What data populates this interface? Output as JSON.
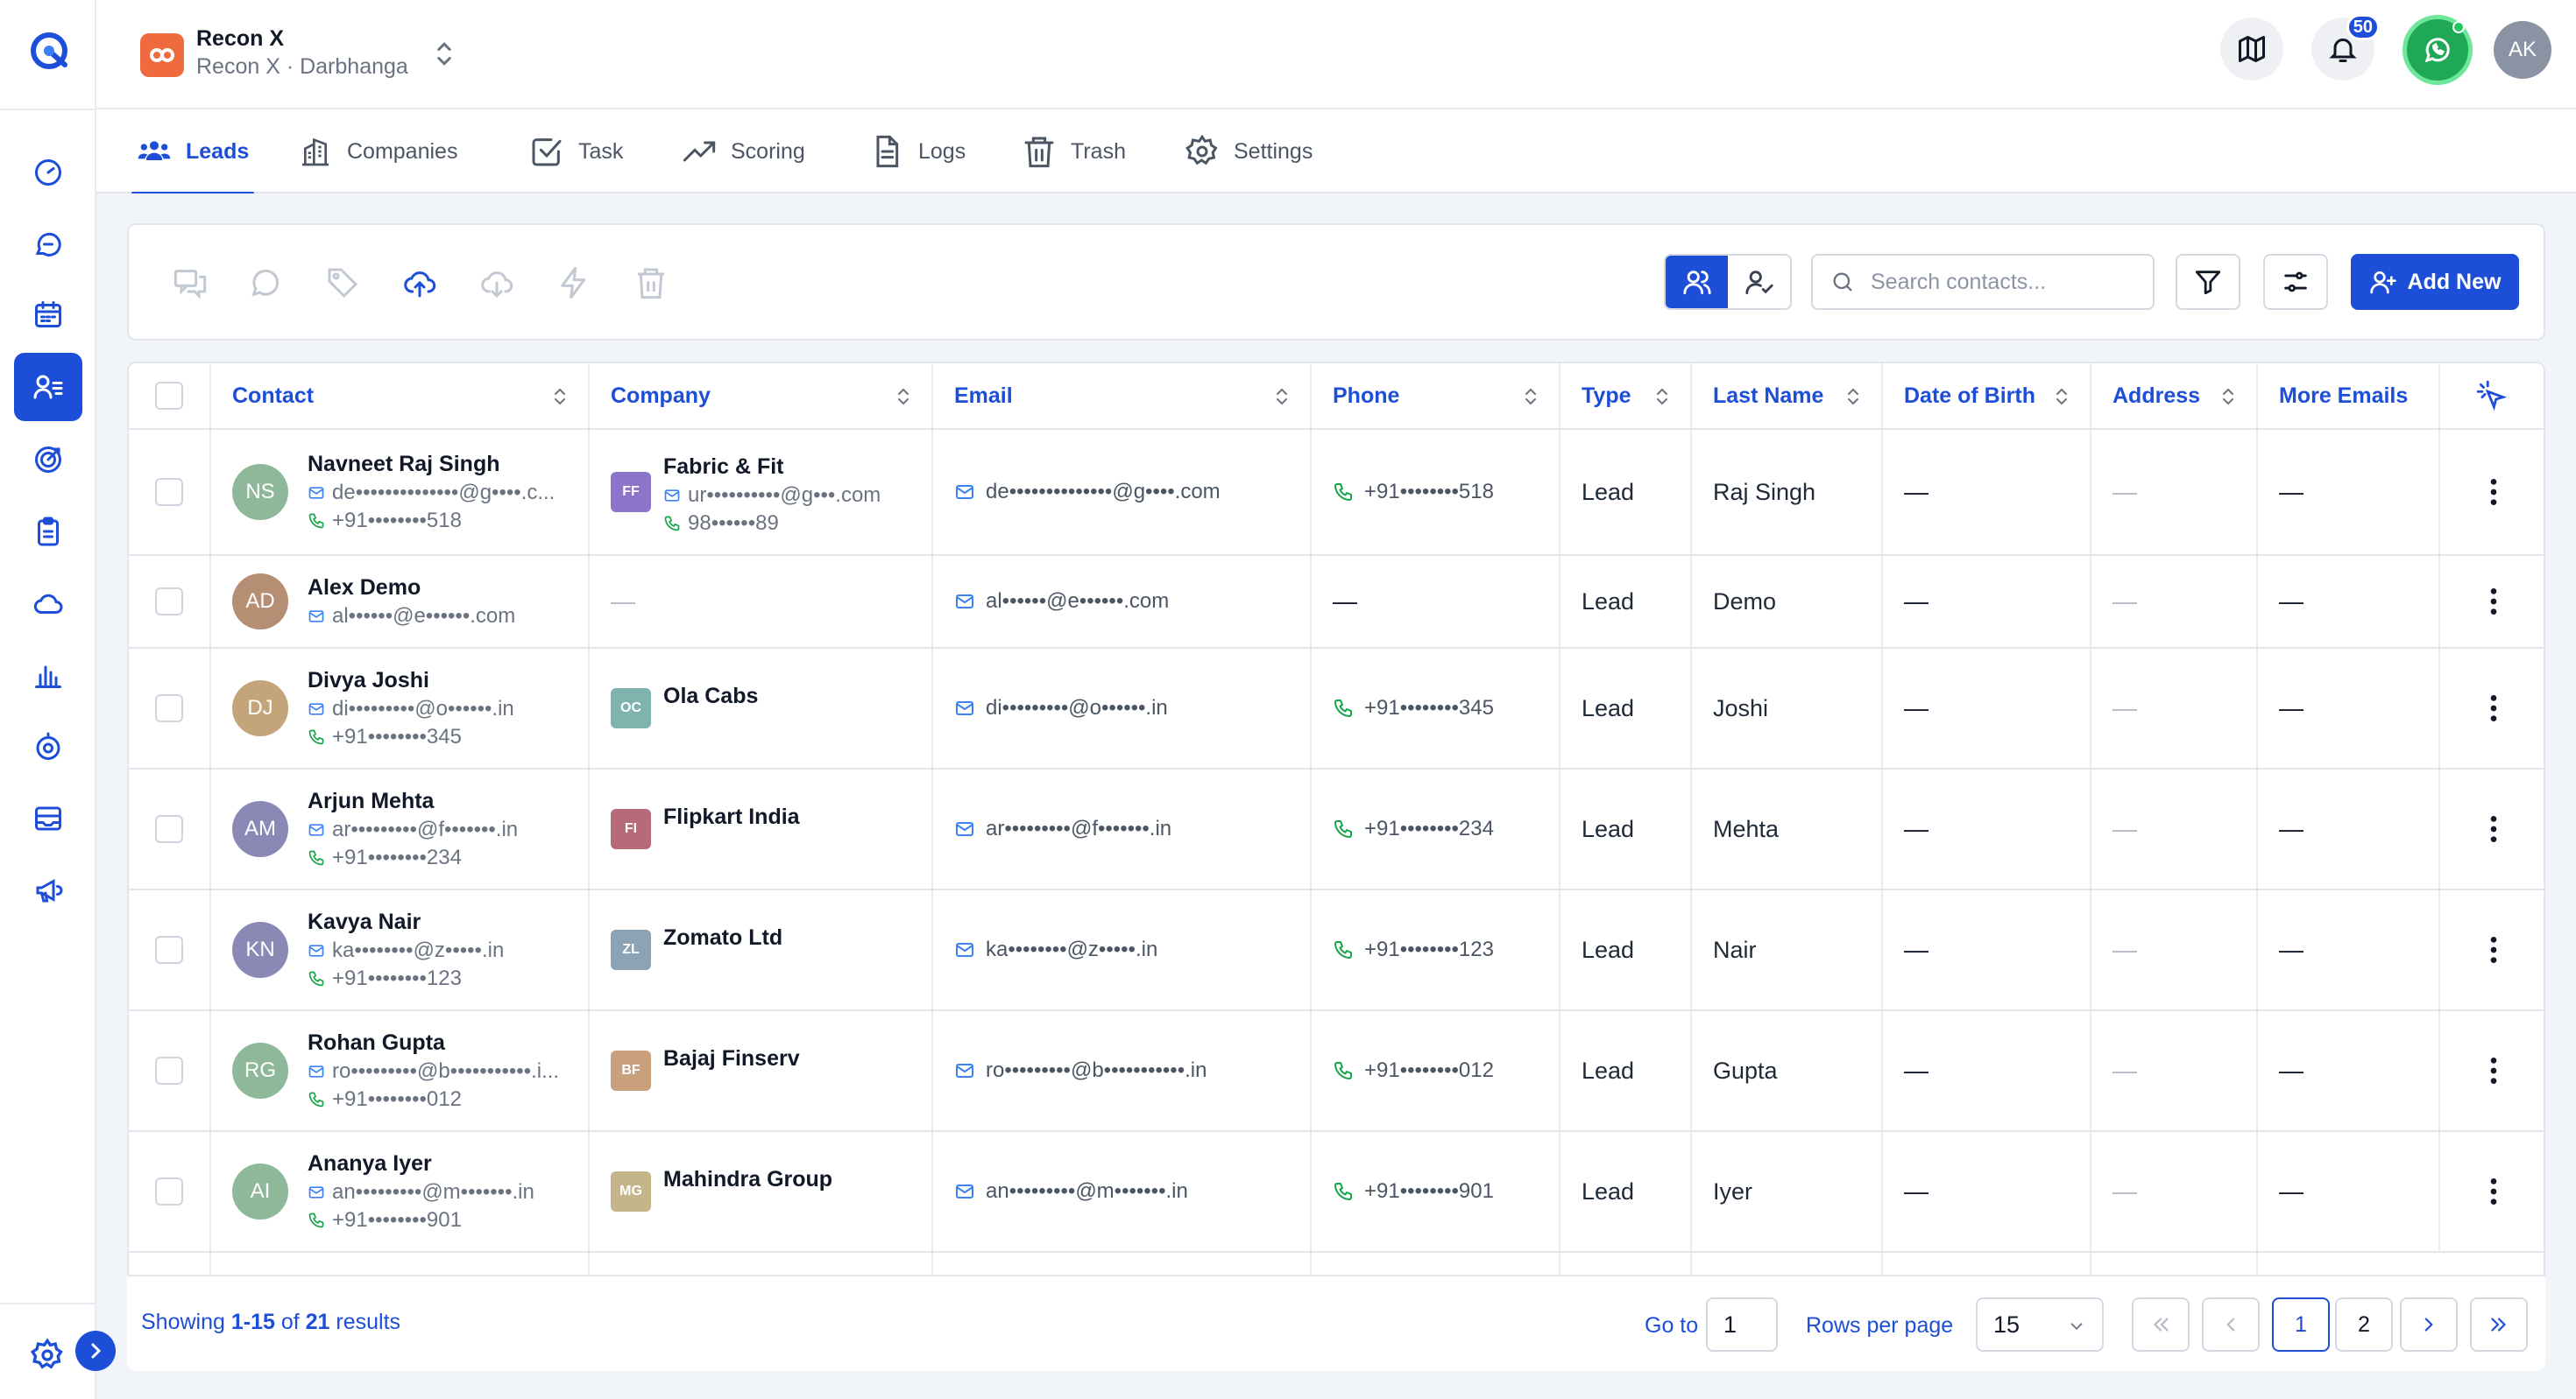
{
  "workspace": {
    "name": "Recon X",
    "subtitle": "Recon X · Darbhanga"
  },
  "header": {
    "notification_count": "50",
    "user_initials": "AK"
  },
  "tabs": [
    {
      "label": "Leads",
      "icon": "users-icon"
    },
    {
      "label": "Companies",
      "icon": "building-icon"
    },
    {
      "label": "Task",
      "icon": "checkbox-icon"
    },
    {
      "label": "Scoring",
      "icon": "trending-up-icon"
    },
    {
      "label": "Logs",
      "icon": "document-icon"
    },
    {
      "label": "Trash",
      "icon": "trash-icon"
    },
    {
      "label": "Settings",
      "icon": "gear-icon"
    }
  ],
  "toolbar": {
    "search_placeholder": "Search contacts...",
    "add_label": "Add New"
  },
  "table": {
    "columns": [
      "Contact",
      "Company",
      "Email",
      "Phone",
      "Type",
      "Last Name",
      "Date of Birth",
      "Address",
      "More Emails"
    ],
    "rows": [
      {
        "initials": "NS",
        "avatar_color": "#8fb89a",
        "name": "Navneet Raj Singh",
        "email_short": "de••••••••••••••@g••••.c...",
        "phone": "+91••••••••518",
        "company": "Fabric & Fit",
        "company_initials": "FF",
        "company_color": "#8b74c9",
        "company_email": "ur••••••••••@g•••.com",
        "company_phone": "98••••••89",
        "email": "de••••••••••••••@g••••.com",
        "phone_col": "+91••••••••518",
        "type": "Lead",
        "last_name": "Raj Singh",
        "dob": "—",
        "address": "—",
        "more_emails": "—"
      },
      {
        "initials": "AD",
        "avatar_color": "#b68e73",
        "name": "Alex Demo",
        "email_short": "al••••••@e••••••.com",
        "phone": "",
        "company": "",
        "company_initials": "",
        "company_color": "",
        "company_email": "",
        "company_phone": "",
        "email": "al••••••@e••••••.com",
        "phone_col": "—",
        "type": "Lead",
        "last_name": "Demo",
        "dob": "—",
        "address": "—",
        "more_emails": "—"
      },
      {
        "initials": "DJ",
        "avatar_color": "#c4a57a",
        "name": "Divya Joshi",
        "email_short": "di•••••••••@o••••••.in",
        "phone": "+91••••••••345",
        "company": "Ola Cabs",
        "company_initials": "OC",
        "company_color": "#7fb3ad",
        "company_email": "",
        "company_phone": "",
        "email": "di•••••••••@o••••••.in",
        "phone_col": "+91••••••••345",
        "type": "Lead",
        "last_name": "Joshi",
        "dob": "—",
        "address": "—",
        "more_emails": "—"
      },
      {
        "initials": "AM",
        "avatar_color": "#8a88b5",
        "name": "Arjun Mehta",
        "email_short": "ar•••••••••@f•••••••.in",
        "phone": "+91••••••••234",
        "company": "Flipkart India",
        "company_initials": "FI",
        "company_color": "#b76b78",
        "company_email": "",
        "company_phone": "",
        "email": "ar•••••••••@f•••••••.in",
        "phone_col": "+91••••••••234",
        "type": "Lead",
        "last_name": "Mehta",
        "dob": "—",
        "address": "—",
        "more_emails": "—"
      },
      {
        "initials": "KN",
        "avatar_color": "#8a88b5",
        "name": "Kavya Nair",
        "email_short": "ka••••••••@z•••••.in",
        "phone": "+91••••••••123",
        "company": "Zomato Ltd",
        "company_initials": "ZL",
        "company_color": "#8ba3b5",
        "company_email": "",
        "company_phone": "",
        "email": "ka••••••••@z•••••.in",
        "phone_col": "+91••••••••123",
        "type": "Lead",
        "last_name": "Nair",
        "dob": "—",
        "address": "—",
        "more_emails": "—"
      },
      {
        "initials": "RG",
        "avatar_color": "#8fb89a",
        "name": "Rohan Gupta",
        "email_short": "ro•••••••••@b•••••••••••.i...",
        "phone": "+91••••••••012",
        "company": "Bajaj Finserv",
        "company_initials": "BF",
        "company_color": "#c9a07e",
        "company_email": "",
        "company_phone": "",
        "email": "ro•••••••••@b•••••••••••.in",
        "phone_col": "+91••••••••012",
        "type": "Lead",
        "last_name": "Gupta",
        "dob": "—",
        "address": "—",
        "more_emails": "—"
      },
      {
        "initials": "AI",
        "avatar_color": "#8fb89a",
        "name": "Ananya Iyer",
        "email_short": "an•••••••••@m•••••••.in",
        "phone": "+91••••••••901",
        "company": "Mahindra Group",
        "company_initials": "MG",
        "company_color": "#c5b58a",
        "company_email": "",
        "company_phone": "",
        "email": "an•••••••••@m•••••••.in",
        "phone_col": "+91••••••••901",
        "type": "Lead",
        "last_name": "Iyer",
        "dob": "—",
        "address": "—",
        "more_emails": "—"
      }
    ]
  },
  "footer": {
    "showing_prefix": "Showing ",
    "showing_range": "1-15",
    "showing_mid": " of ",
    "showing_total": "21",
    "showing_suffix": " results",
    "goto_label": "Go to",
    "goto_value": "1",
    "rows_per_page_label": "Rows per page",
    "rows_per_page_value": "15",
    "pages": [
      "1",
      "2"
    ]
  },
  "colors": {
    "accent": "#1d4ed8",
    "whatsapp": "#1fa855",
    "workspace_logo": "#ef6a3e"
  }
}
